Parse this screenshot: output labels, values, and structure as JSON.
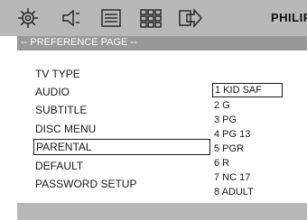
{
  "toolbar": {
    "icons": [
      "gear-icon",
      "speaker-icon",
      "subtitle-icon",
      "grid-icon",
      "arrow-right-icon"
    ],
    "brand": "PHILIP"
  },
  "page": {
    "title": "-- PREFERENCE PAGE --"
  },
  "menu": {
    "items": [
      {
        "label": "TV TYPE"
      },
      {
        "label": "AUDIO"
      },
      {
        "label": "SUBTITLE"
      },
      {
        "label": "DISC MENU"
      },
      {
        "label": "PARENTAL",
        "selected": true
      },
      {
        "label": "DEFAULT"
      },
      {
        "label": "PASSWORD SETUP"
      }
    ]
  },
  "parental_options": {
    "items": [
      {
        "label": "1 KID SAF",
        "selected": true
      },
      {
        "label": "2 G"
      },
      {
        "label": "3 PG"
      },
      {
        "label": "4 PG 13"
      },
      {
        "label": "5 PGR"
      },
      {
        "label": "6 R"
      },
      {
        "label": "7 NC 17"
      },
      {
        "label": "8 ADULT"
      }
    ]
  },
  "colors": {
    "toolbar_bg": "#b8b8b8",
    "header_bg": "#999999",
    "content_bg": "#ffffff",
    "text": "#1a1a1a"
  }
}
